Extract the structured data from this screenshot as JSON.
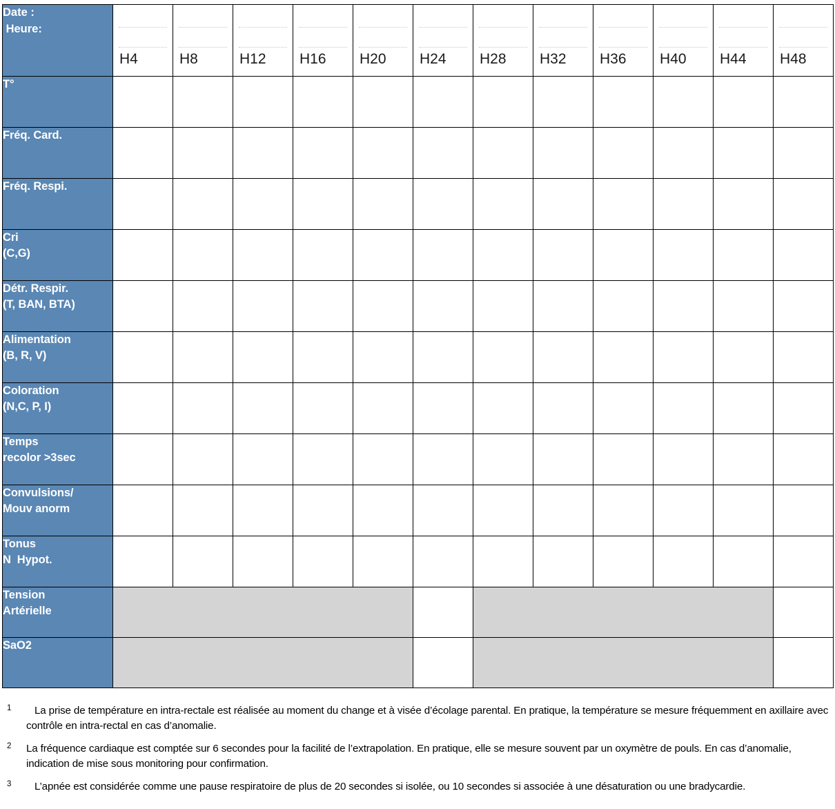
{
  "table": {
    "header": {
      "date_label": "Date :",
      "heure_label": " Heure:",
      "hours": [
        "H4",
        "H8",
        "H12",
        "H16",
        "H20",
        "H24",
        "H28",
        "H32",
        "H36",
        "H40",
        "H44",
        "H48"
      ]
    },
    "rows": [
      {
        "line1": "T°",
        "line2": "",
        "type": "single"
      },
      {
        "line1": "Fréq. Card.",
        "line2": "",
        "type": "single"
      },
      {
        "line1": "Fréq. Respi.",
        "line2": "",
        "type": "single"
      },
      {
        "line1": "Cri",
        "line2": "(C,G)",
        "type": "double"
      },
      {
        "line1": "Détr. Respir.",
        "line2": "(T, BAN, BTA)",
        "type": "double"
      },
      {
        "line1": "Alimentation",
        "line2": "(B, R, V)",
        "type": "double"
      },
      {
        "line1": "Coloration",
        "line2": "(N,C, P, I)",
        "type": "double"
      },
      {
        "line1": "Temps",
        "line2": "recolor >3sec",
        "type": "double"
      },
      {
        "line1": "Convulsions/",
        "line2": "Mouv anorm",
        "type": "double"
      },
      {
        "line1": "Tonus",
        "line2": "N  Hypot.",
        "type": "double"
      },
      {
        "line1": "Tension",
        "line2": "Artérielle",
        "type": "shaded"
      },
      {
        "line1": "SaO2",
        "line2": "",
        "type": "shaded"
      }
    ],
    "shaded_pattern": [
      true,
      true,
      true,
      true,
      true,
      false,
      true,
      true,
      true,
      true,
      true,
      false
    ],
    "colors": {
      "label_blue": "#5a87b4",
      "shaded_gray": "#d4d4d4",
      "grid_line": "#000000",
      "dotted_line": "#c9c9c9"
    }
  },
  "footnotes": [
    {
      "mark": "1",
      "text": "La prise de température en intra-rectale est réalisée au moment du change et à visée d’écolage parental. En pratique, la température se mesure fréquemment en axillaire avec contrôle en intra-rectal en cas d’anomalie."
    },
    {
      "mark": "2",
      "text": "La fréquence cardiaque est comptée sur 6 secondes pour la facilité de l’extrapolation. En pratique, elle se mesure souvent par un oxymètre de pouls. En cas d’anomalie, indication de mise sous monitoring pour confirmation."
    },
    {
      "mark": "3",
      "text": "L’apnée est considérée comme une pause respiratoire de plus de 20 secondes si isolée, ou 10 secondes si associée à une désaturation ou une bradycardie."
    }
  ]
}
